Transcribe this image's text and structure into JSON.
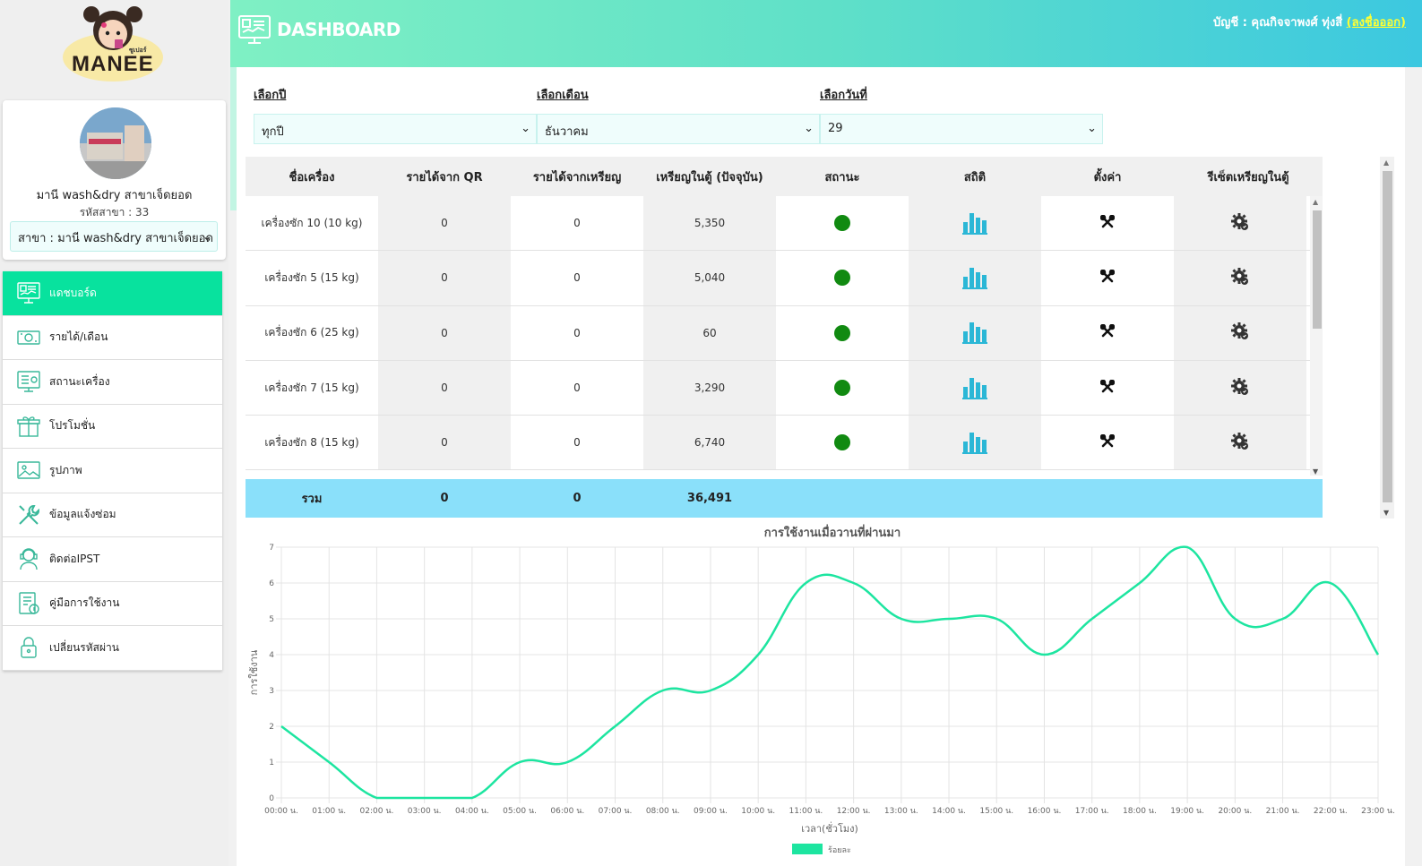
{
  "brand": {
    "logo_text": "MANEE",
    "logo_small": "ซูเปอร์"
  },
  "header": {
    "title": "DASHBOARD",
    "account_label": "บัญชี : คุณกิจจาพงศ์ ทุ่งสี่",
    "logout_label": "(ลงชื่อออก)"
  },
  "profile": {
    "branch_name": "มานี wash&dry สาขาเจ็ดยอด",
    "branch_code": "รหัสสาขา : 33",
    "branch_select": "สาขา : มานี wash&dry สาขาเจ็ดยอด"
  },
  "nav": {
    "items": [
      {
        "label": "แดชบอร์ด",
        "icon": "dashboard-icon",
        "active": true
      },
      {
        "label": "รายได้/เดือน",
        "icon": "money-icon"
      },
      {
        "label": "สถานะเครื่อง",
        "icon": "machine-status-icon"
      },
      {
        "label": "โปรโมชั่น",
        "icon": "gift-icon"
      },
      {
        "label": "รูปภาพ",
        "icon": "image-icon"
      },
      {
        "label": "ข้อมูลแจ้งซ่อม",
        "icon": "tools-icon"
      },
      {
        "label": "ติดต่อIPST",
        "icon": "support-agent-icon"
      },
      {
        "label": "คู่มือการใช้งาน",
        "icon": "manual-icon"
      },
      {
        "label": "เปลี่ยนรหัสผ่าน",
        "icon": "lock-icon"
      }
    ]
  },
  "filters": {
    "year_label": "เลือกปี",
    "year_value": "ทุกปี",
    "month_label": "เลือกเดือน",
    "month_value": "ธันวาคม",
    "day_label": "เลือกวันที่",
    "day_value": "29"
  },
  "table": {
    "headers": [
      "ชื่อเครื่อง",
      "รายได้จาก QR",
      "รายได้จากเหรียญ",
      "เหรียญในตู้ (ปัจจุบัน)",
      "สถานะ",
      "สถิติ",
      "ตั้งค่า",
      "รีเซ็ตเหรียญในตู้"
    ],
    "rows": [
      {
        "name": "เครื่องซัก 10 (10 kg)",
        "qr": "0",
        "coin": "0",
        "box": "5,350"
      },
      {
        "name": "เครื่องซัก 5 (15 kg)",
        "qr": "0",
        "coin": "0",
        "box": "5,040"
      },
      {
        "name": "เครื่องซัก 6 (25 kg)",
        "qr": "0",
        "coin": "0",
        "box": "60"
      },
      {
        "name": "เครื่องซัก 7 (15 kg)",
        "qr": "0",
        "coin": "0",
        "box": "3,290"
      },
      {
        "name": "เครื่องซัก 8 (15 kg)",
        "qr": "0",
        "coin": "0",
        "box": "6,740"
      }
    ],
    "total": {
      "label": "รวม",
      "qr": "0",
      "coin": "0",
      "box": "36,491"
    },
    "status_color": "#118a11",
    "stat_color": "#2bb7d6"
  },
  "chart_data": {
    "type": "line",
    "title": "การใช้งานเมื่อวานที่ผ่านมา",
    "xlabel": "เวลา(ชั่วโมง)",
    "ylabel": "การใช้งาน",
    "ylim": [
      0,
      7
    ],
    "grid": true,
    "legend": "bottom-center",
    "color": "#1de5a0",
    "categories": [
      "00:00 น.",
      "01:00 น.",
      "02:00 น.",
      "03:00 น.",
      "04:00 น.",
      "05:00 น.",
      "06:00 น.",
      "07:00 น.",
      "08:00 น.",
      "09:00 น.",
      "10:00 น.",
      "11:00 น.",
      "12:00 น.",
      "13:00 น.",
      "14:00 น.",
      "15:00 น.",
      "16:00 น.",
      "17:00 น.",
      "18:00 น.",
      "19:00 น.",
      "20:00 น.",
      "21:00 น.",
      "22:00 น.",
      "23:00 น."
    ],
    "series": [
      {
        "name": "ร้อยละ",
        "values": [
          2,
          1,
          0,
          0,
          0,
          1,
          1,
          2,
          3,
          3,
          4,
          6,
          6,
          5,
          5,
          5,
          4,
          5,
          6,
          7,
          5,
          5,
          6,
          4
        ]
      }
    ]
  }
}
